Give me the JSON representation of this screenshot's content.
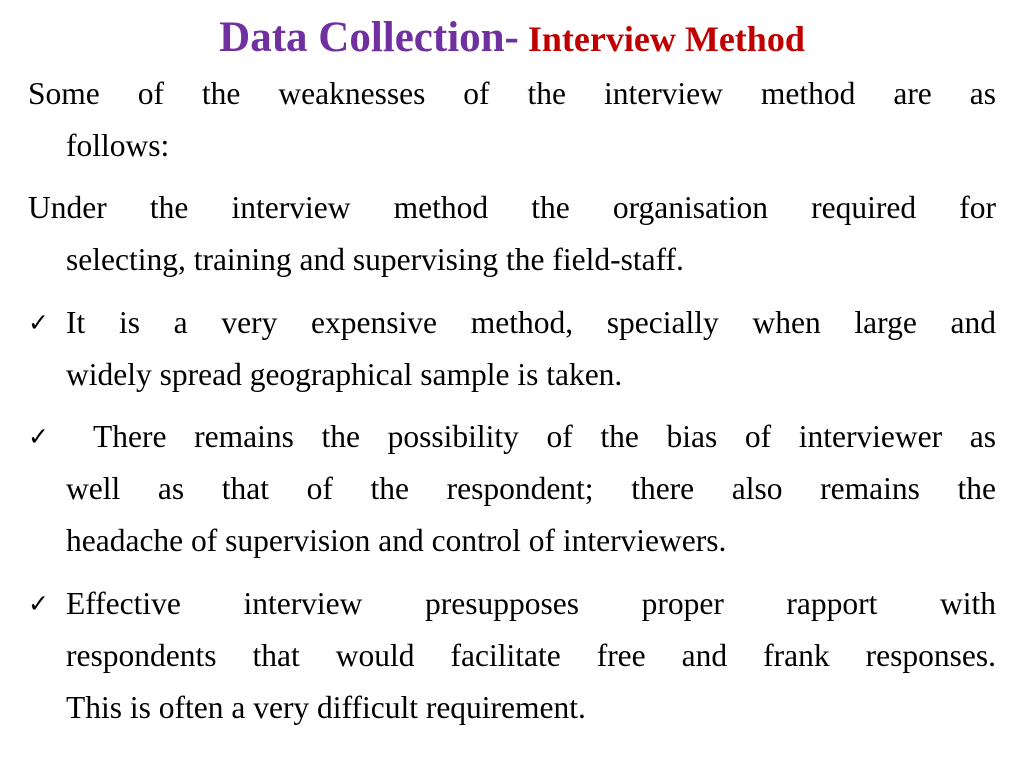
{
  "title": {
    "part1": "Data Collection-",
    "part2": " Interview Method",
    "colors": {
      "part1": "#7030A0",
      "part2": "#C00000"
    }
  },
  "intro": {
    "line1": "Some of the weaknesses of the interview method are as",
    "line2": "follows:"
  },
  "paragraph": {
    "line1": "Under the interview method the organisation required for",
    "line2": "selecting, training and supervising the field-staff."
  },
  "bullets": [
    {
      "icon": "check-icon",
      "lines": [
        "It is a very expensive method, specially when large and",
        "widely spread geographical sample is taken."
      ]
    },
    {
      "icon": "check-icon",
      "lines": [
        " There remains the possibility of the bias of interviewer as",
        "well as that of the respondent; there also remains the",
        "headache of supervision and control of interviewers."
      ]
    },
    {
      "icon": "check-icon",
      "lines": [
        " Effective interview presupposes proper rapport with",
        "respondents that would facilitate free and frank responses.",
        "This is often a very difficult requirement."
      ]
    }
  ],
  "check_glyph": "✓"
}
